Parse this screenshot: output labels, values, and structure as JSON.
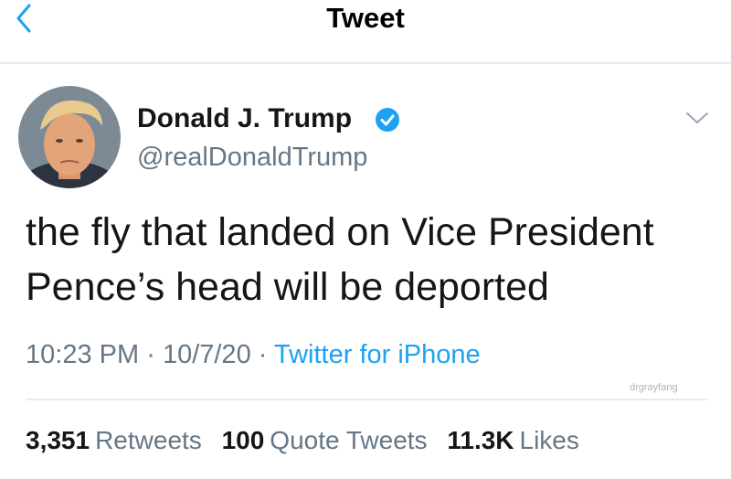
{
  "header": {
    "title": "Tweet",
    "back_icon": "chevron-left-icon"
  },
  "author": {
    "name": "Donald J. Trump",
    "handle": "@realDonaldTrump",
    "verified_icon": "verified-badge-icon",
    "menu_icon": "chevron-down-icon"
  },
  "tweet": {
    "text": "the fly that landed on Vice President Pence’s head will be deported"
  },
  "meta": {
    "time": "10:23 PM",
    "date": "10/7/20",
    "separator": "·",
    "source": "Twitter for iPhone"
  },
  "watermark": "drgrayfang",
  "stats": {
    "retweets_count": "3,351",
    "retweets_label": "Retweets",
    "quotes_count": "100",
    "quotes_label": "Quote Tweets",
    "likes_count": "11.3K",
    "likes_label": "Likes"
  },
  "colors": {
    "accent": "#1da1f2",
    "text": "#14171a",
    "secondary": "#657786",
    "divider": "#e6ecf0"
  }
}
